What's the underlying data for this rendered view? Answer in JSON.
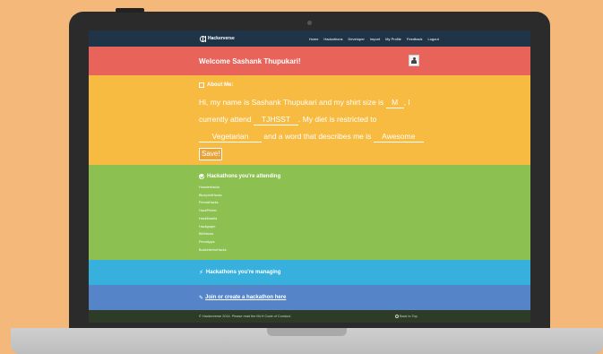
{
  "navbar": {
    "brand": "Hackerverse",
    "links": [
      "Home",
      "Hackathons",
      "Developer",
      "Import",
      "My Profile",
      "Feedback",
      "Logout"
    ]
  },
  "welcome": {
    "text": "Welcome Sashank Thupukari!"
  },
  "about": {
    "heading": "About Me:",
    "s1": "Hi, my name is Sashank Thupukari and my shirt size is",
    "shirt": "M",
    "s2": ", I currently attend",
    "school": "TJHSST",
    "s3": ". My diet is restricted to",
    "diet": "Vegetarian",
    "s4": "and a word that describes me is",
    "word": "Awesome",
    "save_label": "Save!"
  },
  "attending": {
    "heading": "Hackathons you're attending",
    "items": [
      "Hoosierhacks",
      "BlueprintHacks",
      "PennaHacks",
      "HackPrinter",
      "HackMadrid",
      "Hackgraph",
      "BMHacks",
      "PennApps",
      "BuckInterimHacks"
    ]
  },
  "managing": {
    "heading": "Hackathons you're managing"
  },
  "join": {
    "heading": "Join or create a hackathon here"
  },
  "footer": {
    "left": "© Hackerverse 2014. Please read the MLH Code of Conduct.",
    "back_to_top": "Back to Top"
  },
  "colors": {
    "navbar": "#1f3447",
    "welcome": "#e8635a",
    "about": "#f7bb42",
    "attending": "#8cc152",
    "managing": "#38b0de",
    "join": "#5584c8",
    "background": "#f4b87a"
  }
}
